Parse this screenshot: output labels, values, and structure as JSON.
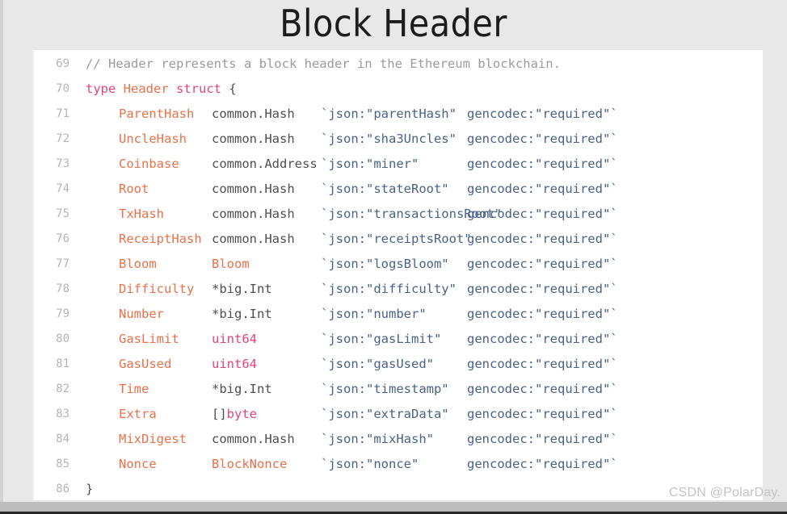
{
  "slide": {
    "title": "Block Header",
    "background_color": "#e8e8e8",
    "panel_color": "#ffffff"
  },
  "watermark": {
    "text": "CSDN @PolarDay."
  },
  "colors": {
    "comment": "#9b9b9b",
    "keyword": "#e0457b",
    "type_name": "#e8714a",
    "field_name": "#e8714a",
    "builtin_type": "#e0457b",
    "plain": "#4f4f4f",
    "struct_tag": "#4a6287",
    "line_number": "#b5b5b5",
    "title": "#1c1c1c"
  },
  "code": {
    "language": "go",
    "first_line_number": 69,
    "lines": [
      {
        "number": "69",
        "kind": "comment",
        "text": "// Header represents a block header in the Ethereum blockchain."
      },
      {
        "number": "70",
        "kind": "declaration",
        "keyword1": "type",
        "name": "Header",
        "keyword2": "struct",
        "brace": "{"
      },
      {
        "number": "71",
        "kind": "field",
        "field": "ParentHash",
        "type": "common.Hash",
        "type_style": "plain",
        "json": "`json:\"parentHash\"",
        "gencodec": "gencodec:\"required\"`"
      },
      {
        "number": "72",
        "kind": "field",
        "field": "UncleHash",
        "type": "common.Hash",
        "type_style": "plain",
        "json": "`json:\"sha3Uncles\"",
        "gencodec": "gencodec:\"required\"`"
      },
      {
        "number": "73",
        "kind": "field",
        "field": "Coinbase",
        "type": "common.Address",
        "type_style": "plain",
        "json": "`json:\"miner\"",
        "gencodec": "gencodec:\"required\"`"
      },
      {
        "number": "74",
        "kind": "field",
        "field": "Root",
        "type": "common.Hash",
        "type_style": "plain",
        "json": "`json:\"stateRoot\"",
        "gencodec": "gencodec:\"required\"`"
      },
      {
        "number": "75",
        "kind": "field",
        "field": "TxHash",
        "type": "common.Hash",
        "type_style": "plain",
        "json": "`json:\"transactionsRoot\"",
        "gencodec": "gencodec:\"required\"`"
      },
      {
        "number": "76",
        "kind": "field",
        "field": "ReceiptHash",
        "type": "common.Hash",
        "type_style": "plain",
        "json": "`json:\"receiptsRoot\"",
        "gencodec": "gencodec:\"required\"`"
      },
      {
        "number": "77",
        "kind": "field",
        "field": "Bloom",
        "type": "Bloom",
        "type_style": "type",
        "json": "`json:\"logsBloom\"",
        "gencodec": "gencodec:\"required\"`"
      },
      {
        "number": "78",
        "kind": "field",
        "field": "Difficulty",
        "type": "*big.Int",
        "type_style": "plain",
        "json": "`json:\"difficulty\"",
        "gencodec": "gencodec:\"required\"`"
      },
      {
        "number": "79",
        "kind": "field",
        "field": "Number",
        "type": "*big.Int",
        "type_style": "plain",
        "json": "`json:\"number\"",
        "gencodec": "gencodec:\"required\"`"
      },
      {
        "number": "80",
        "kind": "field",
        "field": "GasLimit",
        "type": "uint64",
        "type_style": "builtin",
        "json": "`json:\"gasLimit\"",
        "gencodec": "gencodec:\"required\"`"
      },
      {
        "number": "81",
        "kind": "field",
        "field": "GasUsed",
        "type": "uint64",
        "type_style": "builtin",
        "json": "`json:\"gasUsed\"",
        "gencodec": "gencodec:\"required\"`"
      },
      {
        "number": "82",
        "kind": "field",
        "field": "Time",
        "type": "*big.Int",
        "type_style": "plain",
        "json": "`json:\"timestamp\"",
        "gencodec": "gencodec:\"required\"`"
      },
      {
        "number": "83",
        "kind": "field",
        "field": "Extra",
        "type_prefix": "[]",
        "type": "byte",
        "type_style": "builtin-suffix",
        "json": "`json:\"extraData\"",
        "gencodec": "gencodec:\"required\"`"
      },
      {
        "number": "84",
        "kind": "field",
        "field": "MixDigest",
        "type": "common.Hash",
        "type_style": "plain",
        "json": "`json:\"mixHash\"",
        "gencodec": "gencodec:\"required\"`"
      },
      {
        "number": "85",
        "kind": "field",
        "field": "Nonce",
        "type": "BlockNonce",
        "type_style": "type",
        "json": "`json:\"nonce\"",
        "gencodec": "gencodec:\"required\"`"
      },
      {
        "number": "86",
        "kind": "close",
        "brace": "}"
      }
    ]
  }
}
